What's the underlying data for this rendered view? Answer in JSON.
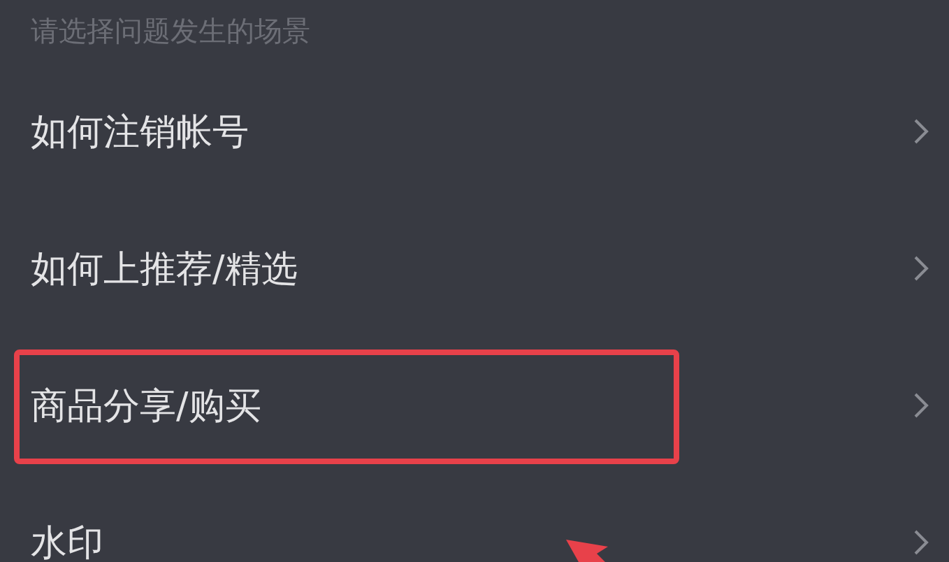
{
  "header": "请选择问题发生的场景",
  "items": [
    {
      "label": "如何注销帐号",
      "highlighted": false
    },
    {
      "label": "如何上推荐/精选",
      "highlighted": false
    },
    {
      "label": "商品分享/购买",
      "highlighted": true
    },
    {
      "label": "水印",
      "highlighted": false
    }
  ]
}
